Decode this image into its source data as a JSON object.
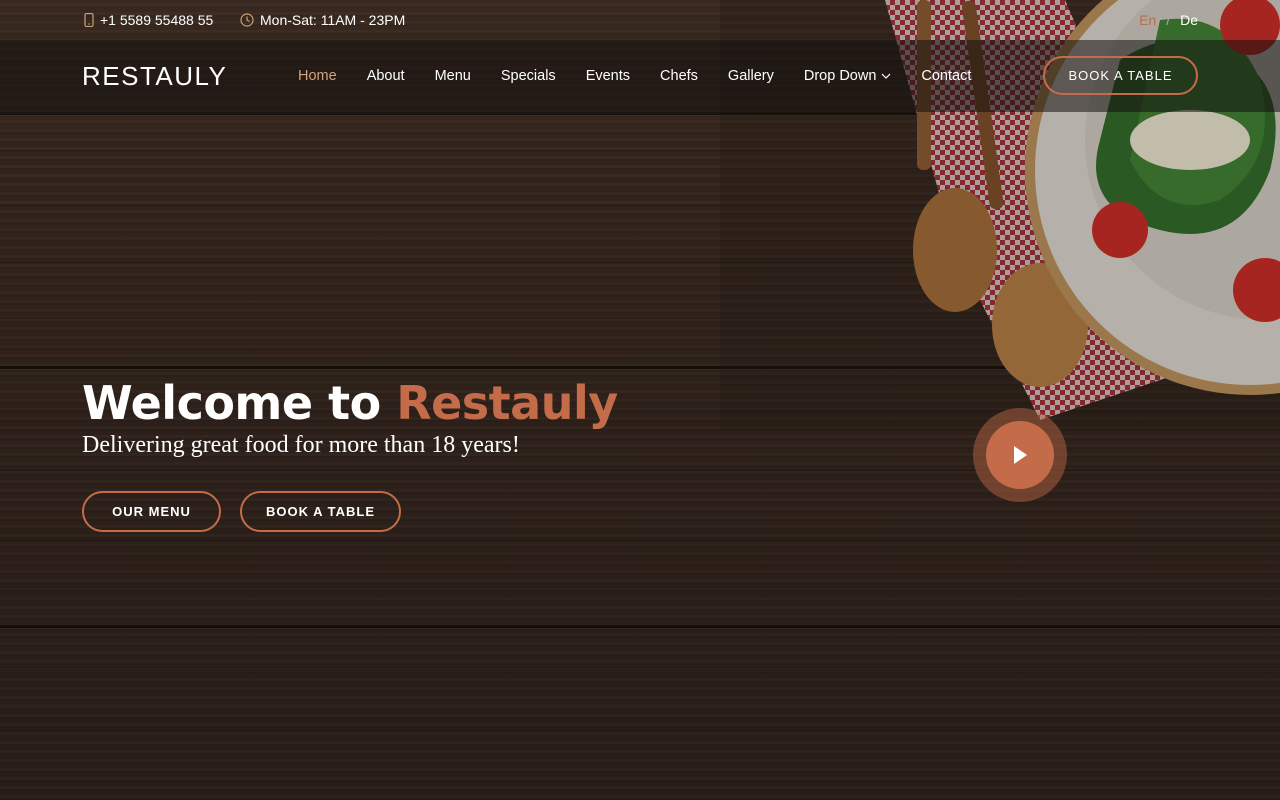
{
  "topbar": {
    "phone": "+1 5589 55488 55",
    "hours": "Mon-Sat: 11AM - 23PM",
    "lang_en": "En",
    "lang_sep": "/",
    "lang_de": "De"
  },
  "header": {
    "logo": "RESTAULY",
    "nav": {
      "home": "Home",
      "about": "About",
      "menu": "Menu",
      "specials": "Specials",
      "events": "Events",
      "chefs": "Chefs",
      "gallery": "Gallery",
      "dropdown": "Drop Down",
      "contact": "Contact"
    },
    "book_button": "BOOK A TABLE"
  },
  "hero": {
    "title_prefix": "Welcome to",
    "title_brand": "Restauly",
    "subtitle": "Delivering great food for more than 18 years!",
    "menu_button": "OUR MENU",
    "book_button": "BOOK A TABLE"
  },
  "colors": {
    "accent": "#c46c4a",
    "nav_active": "#d3a27e",
    "background": "#2e211a"
  },
  "icons": {
    "phone": "mobile-phone-icon",
    "hours": "clock-icon",
    "dropdown": "chevron-down-icon",
    "play": "play-icon"
  }
}
